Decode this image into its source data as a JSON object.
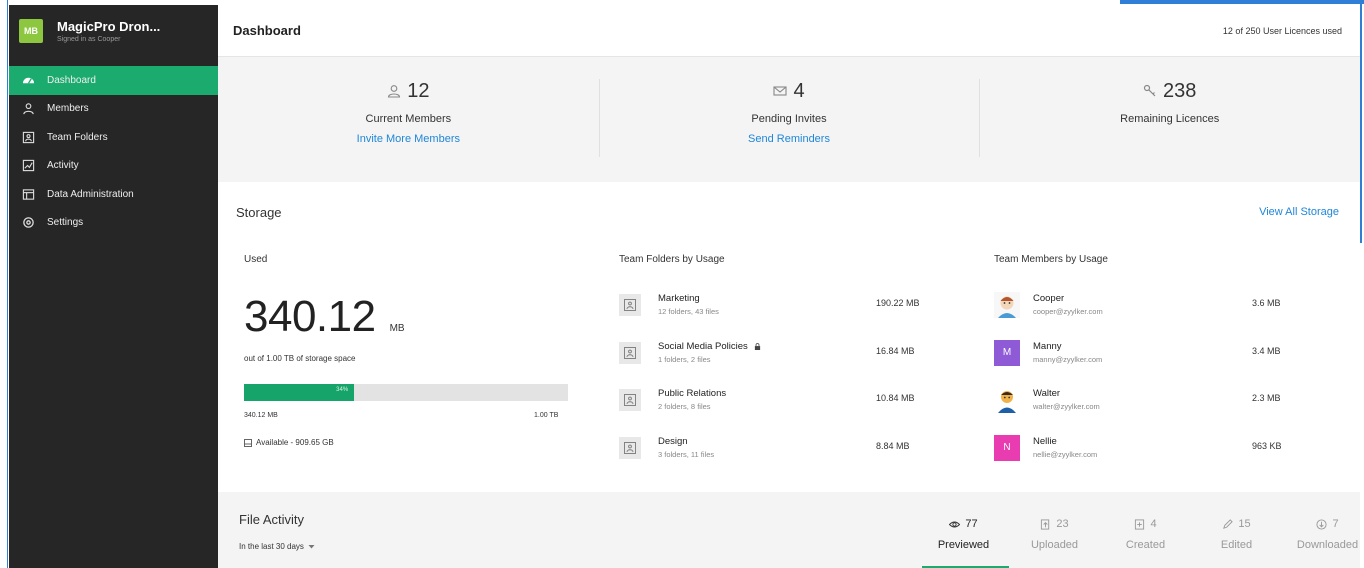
{
  "app": {
    "logo_text": "MB",
    "name": "MagicPro Dron...",
    "signed_in": "Signed in as Cooper"
  },
  "sidebar": {
    "items": [
      {
        "label": "Dashboard",
        "icon": "dashboard-gauge-icon",
        "active": true
      },
      {
        "label": "Members",
        "icon": "members-icon",
        "active": false
      },
      {
        "label": "Team Folders",
        "icon": "team-folders-icon",
        "active": false
      },
      {
        "label": "Activity",
        "icon": "activity-chart-icon",
        "active": false
      },
      {
        "label": "Data Administration",
        "icon": "data-administration-icon",
        "active": false
      },
      {
        "label": "Settings",
        "icon": "settings-icon",
        "active": false
      }
    ]
  },
  "header": {
    "title": "Dashboard",
    "licences_used": "12 of 250 User Licences used"
  },
  "summary": {
    "members": {
      "count": "12",
      "label": "Current Members",
      "link": "Invite More Members",
      "icon": "person-icon"
    },
    "invites": {
      "count": "4",
      "label": "Pending Invites",
      "link": "Send Reminders",
      "icon": "envelope-icon"
    },
    "licences": {
      "count": "238",
      "label": "Remaining Licences",
      "icon": "key-icon"
    }
  },
  "storage": {
    "title": "Storage",
    "view_all": "View All Storage",
    "used": {
      "label": "Used",
      "value": "340.12",
      "unit": "MB",
      "out_of": "out of 1.00 TB of storage space",
      "percent_label": "34%",
      "percent": 34,
      "bar_left": "340.12 MB",
      "bar_right": "1.00 TB",
      "available": "Available - 909.65 GB"
    },
    "folders": {
      "label": "Team Folders by Usage",
      "items": [
        {
          "name": "Marketing",
          "sub": "12 folders, 43 files",
          "size": "190.22 MB",
          "locked": false
        },
        {
          "name": "Social Media Policies",
          "sub": "1 folders, 2 files",
          "size": "16.84 MB",
          "locked": true
        },
        {
          "name": "Public Relations",
          "sub": "2 folders, 8 files",
          "size": "10.84 MB",
          "locked": false
        },
        {
          "name": "Design",
          "sub": "3 folders, 11 files",
          "size": "8.84 MB",
          "locked": false
        }
      ]
    },
    "members": {
      "label": "Team Members by Usage",
      "items": [
        {
          "name": "Cooper",
          "email": "cooper@zyylker.com",
          "size": "3.6 MB",
          "avatar": "photo",
          "color": "#f3d7b8"
        },
        {
          "name": "Manny",
          "email": "manny@zyylker.com",
          "size": "3.4 MB",
          "avatar": "M",
          "color": "#8e5ad6"
        },
        {
          "name": "Walter",
          "email": "walter@zyylker.com",
          "size": "2.3 MB",
          "avatar": "photo",
          "color": "#f1b24a"
        },
        {
          "name": "Nellie",
          "email": "nellie@zyylker.com",
          "size": "963 KB",
          "avatar": "N",
          "color": "#e93cb0"
        }
      ]
    }
  },
  "activity": {
    "title": "File Activity",
    "range": "In the last 30 days",
    "tabs": [
      {
        "count": "77",
        "label": "Previewed",
        "icon": "eye-icon",
        "active": true
      },
      {
        "count": "23",
        "label": "Uploaded",
        "icon": "upload-icon",
        "active": false
      },
      {
        "count": "4",
        "label": "Created",
        "icon": "create-icon",
        "active": false
      },
      {
        "count": "15",
        "label": "Edited",
        "icon": "pencil-icon",
        "active": false
      },
      {
        "count": "7",
        "label": "Downloaded",
        "icon": "download-icon",
        "active": false
      }
    ]
  },
  "colors": {
    "accent_green": "#1bab6e",
    "link_blue": "#1f86d8",
    "sidebar_bg": "#262626",
    "brand_green": "#8dc63f"
  }
}
